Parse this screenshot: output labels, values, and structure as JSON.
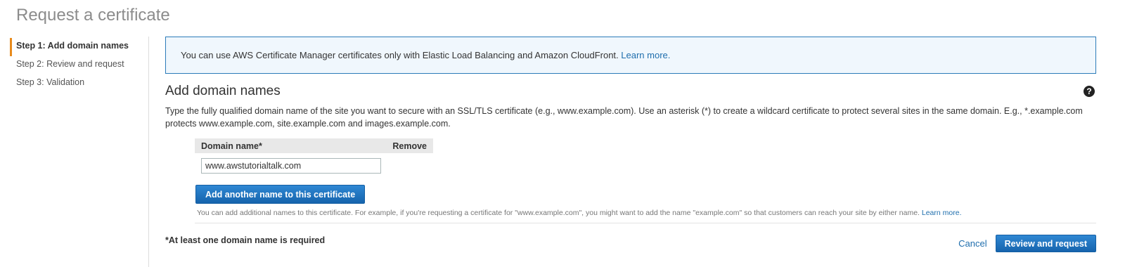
{
  "page": {
    "title": "Request a certificate"
  },
  "steps": [
    {
      "label": "Step 1: Add domain names",
      "active": true
    },
    {
      "label": "Step 2: Review and request",
      "active": false
    },
    {
      "label": "Step 3: Validation",
      "active": false
    }
  ],
  "info": {
    "text": "You can use AWS Certificate Manager certificates only with Elastic Load Balancing and Amazon CloudFront. ",
    "link": "Learn more."
  },
  "section": {
    "title": "Add domain names",
    "help_icon": "?",
    "description": "Type the fully qualified domain name of the site you want to secure with an SSL/TLS certificate (e.g., www.example.com). Use an asterisk (*) to create a wildcard certificate to protect several sites in the same domain. E.g., *.example.com protects www.example.com, site.example.com and images.example.com."
  },
  "table": {
    "col_domain": "Domain name*",
    "col_remove": "Remove",
    "rows": [
      {
        "domain": "www.awstutorialtalk.com"
      }
    ]
  },
  "add_button": "Add another name to this certificate",
  "hint": {
    "text": "You can add additional names to this certificate. For example, if you're requesting a certificate for \"www.example.com\", you might want to add the name \"example.com\" so that customers can reach your site by either name. ",
    "link": "Learn more."
  },
  "footer": {
    "required": "*At least one domain name is required",
    "cancel": "Cancel",
    "review": "Review and request"
  },
  "colors": {
    "accent": "#e88b1d",
    "primary_button": "#1a6fbf",
    "info_border": "#2b7bb9",
    "info_bg": "#f0f7fd",
    "link": "#1f6ead"
  }
}
